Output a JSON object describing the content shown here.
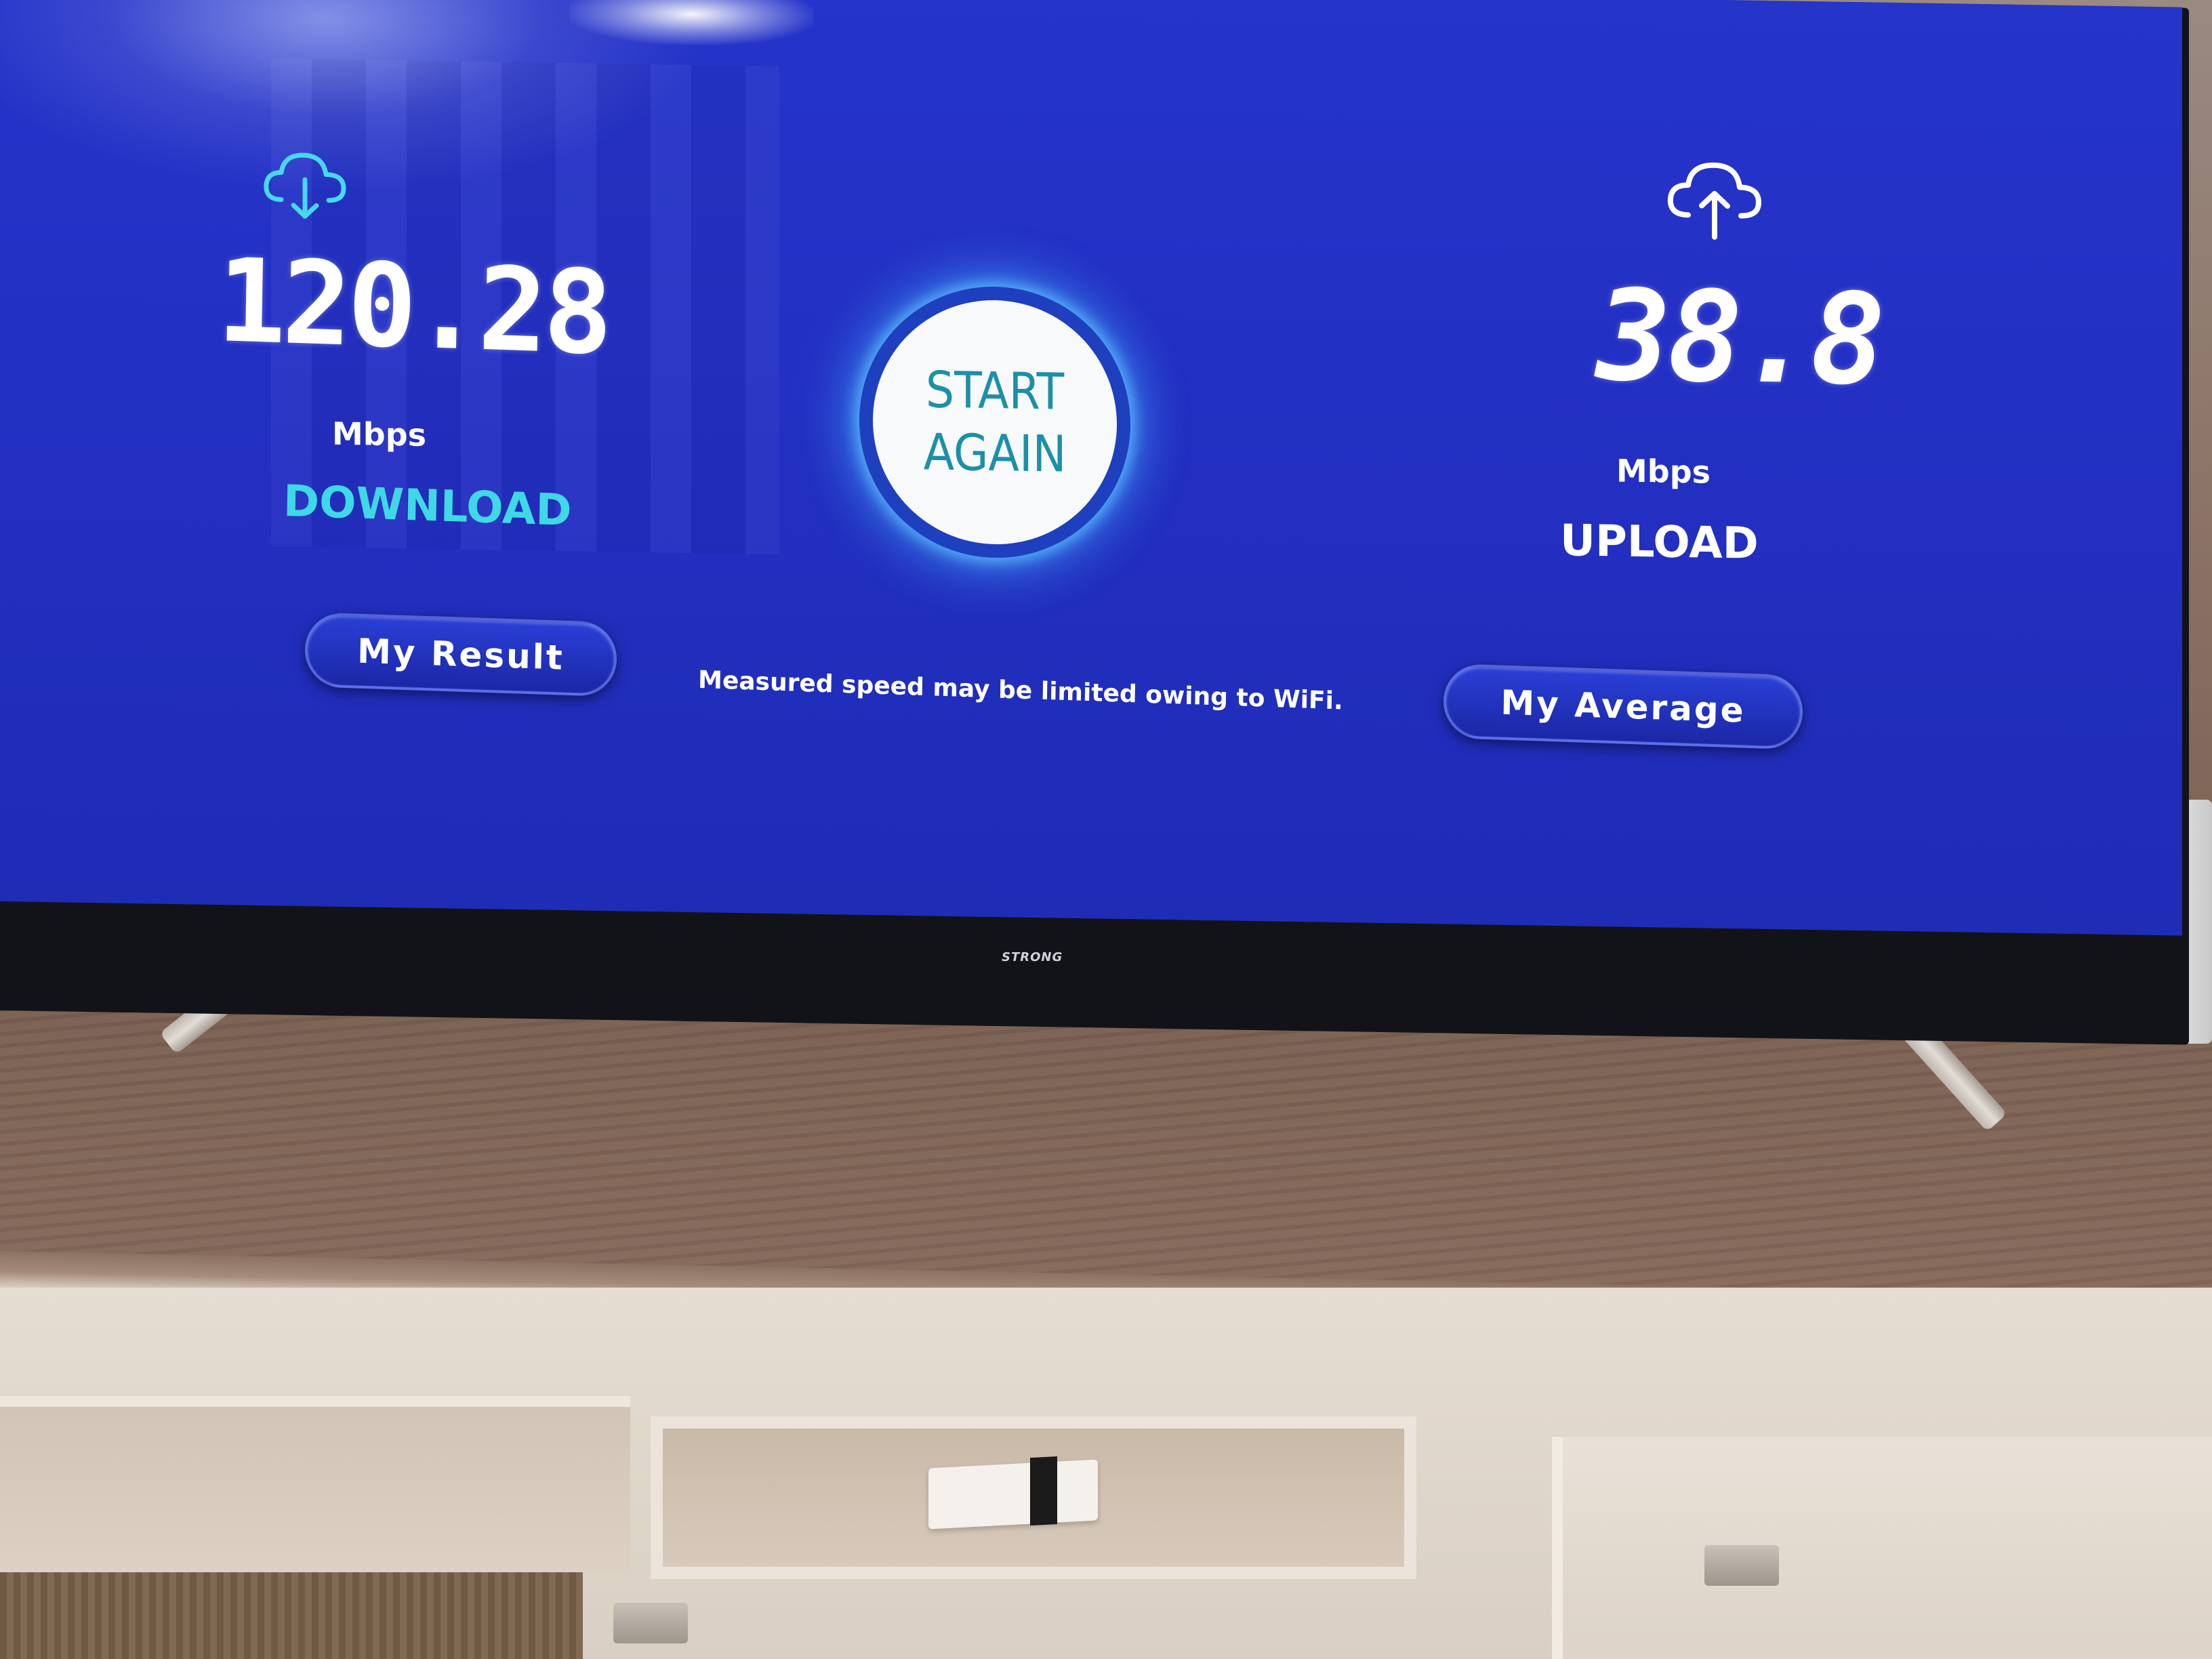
{
  "tv_app": {
    "download": {
      "value": "120.28",
      "unit": "Mbps",
      "label": "DOWNLOAD",
      "icon": "cloud-download-icon"
    },
    "upload": {
      "value": "38.8",
      "unit": "Mbps",
      "label": "UPLOAD",
      "icon": "cloud-upload-icon"
    },
    "start_button": {
      "line1": "START",
      "line2": "AGAIN"
    },
    "buttons": {
      "my_result": "My Result",
      "my_average": "My Average"
    },
    "notice": "Measured speed may be limited owing to WiFi."
  },
  "tv": {
    "brand": "STRONG"
  },
  "colors": {
    "screen_bg": "#2330c4",
    "download_label": "#3fd8e6",
    "upload_label": "#ffffff",
    "start_text": "#1d8fa8",
    "glow": "#3caaff"
  }
}
